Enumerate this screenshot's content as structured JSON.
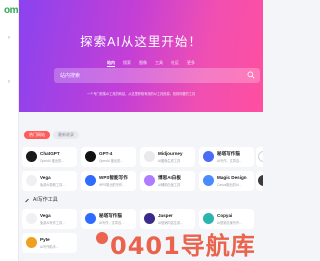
{
  "logo": {
    "text": "om"
  },
  "hero": {
    "title": "探索AI从这里开始！",
    "tabs": [
      "站内",
      "搜索",
      "图像",
      "工具",
      "社区",
      "更多"
    ],
    "search_placeholder": "站内搜索",
    "note": "一个专门收集AI工具的网站，从这里获取有用的AI工具资源，找到你要的工具"
  },
  "tags": {
    "active": "热门网站",
    "other": "最新收录"
  },
  "row1": [
    {
      "name": "ChatGPT",
      "desc": "OpenAI 推出的...",
      "color": "#1a1a1a"
    },
    {
      "name": "GPT-4",
      "desc": "OpenAI 推出的...",
      "color": "#111111"
    },
    {
      "name": "Midjourney",
      "desc": "AI图像生成工具",
      "color": "#2b2b2b"
    },
    {
      "name": "秘塔写作猫",
      "desc": "AI写作，文章自...",
      "color": "#4a6cf7"
    }
  ],
  "row2": [
    {
      "name": "Vega",
      "desc": "免费AI视频工具...",
      "color": "#1a1a1a"
    },
    {
      "name": "WPS智能写作",
      "desc": "WPS推出的写作...",
      "color": "#2f6bff"
    },
    {
      "name": "博思AI白板",
      "desc": "AI辅助白板工具",
      "color": "#7b4dff"
    },
    {
      "name": "Magic Design",
      "desc": "Canva推出的AI...",
      "color": "#4a8cff"
    }
  ],
  "section": {
    "title": "AI写作工具"
  },
  "row3": [
    {
      "name": "Vega",
      "desc": "免费AI写作工具...",
      "color": "#1a1a1a"
    },
    {
      "name": "秘塔写作猫",
      "desc": "AI写作，文章自...",
      "color": "#2f6bff"
    },
    {
      "name": "Jasper",
      "desc": "AI营销内容生成...",
      "color": "#3a2a8a"
    },
    {
      "name": "Copyai",
      "desc": "AI营销文案写作...",
      "color": "#2ab5b0"
    }
  ],
  "row4": [
    {
      "name": "Pyte",
      "desc": "AI写作助手...",
      "color": "#f0a020"
    }
  ],
  "watermark": {
    "text": "0401导航库"
  }
}
